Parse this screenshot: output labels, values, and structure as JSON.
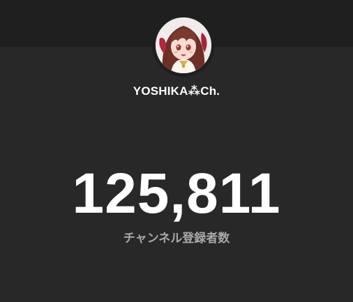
{
  "channel": {
    "name": "YOSHIKA⁂Ch.",
    "avatar_icon": "channel-avatar-illustration"
  },
  "stats": {
    "subscriber_count": "125,811",
    "subscriber_label": "チャンネル登録者数"
  },
  "colors": {
    "background": "#282828",
    "top_band": "#1f1f1f",
    "text_primary": "#ffffff",
    "text_secondary": "#a9a9a9"
  }
}
